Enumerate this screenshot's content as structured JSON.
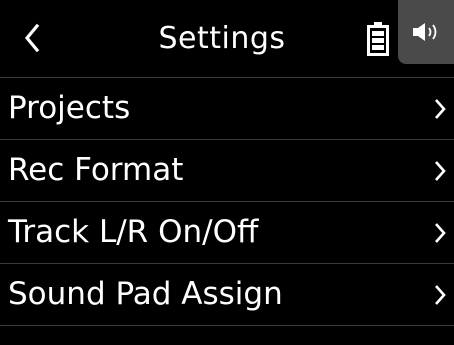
{
  "header": {
    "title": "Settings",
    "back_icon": "chevron-left-icon",
    "battery_icon": "battery-icon",
    "speaker_icon": "speaker-icon"
  },
  "menu": {
    "items": [
      {
        "label": "Projects",
        "icon": "chevron-right-icon"
      },
      {
        "label": "Rec Format",
        "icon": "chevron-right-icon"
      },
      {
        "label": "Track L/R On/Off",
        "icon": "chevron-right-icon"
      },
      {
        "label": "Sound Pad Assign",
        "icon": "chevron-right-icon"
      }
    ]
  },
  "colors": {
    "background": "#000000",
    "text": "#ffffff",
    "divider": "#3a3a3a",
    "speaker_tab": "#4a4a4a"
  }
}
